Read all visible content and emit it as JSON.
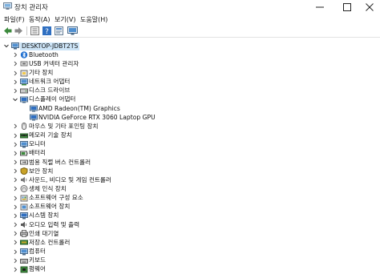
{
  "window": {
    "title": "장치 관리자"
  },
  "menu": [
    "파일(F)",
    "동작(A)",
    "보기(V)",
    "도움말(H)"
  ],
  "tree": {
    "root": "DESKTOP-JDBT2TS",
    "items": [
      {
        "label": "Bluetooth",
        "icon": "bluetooth-icon",
        "expanded": false,
        "level": 1
      },
      {
        "label": "USB 커넥터 관리자",
        "icon": "usb-connector-icon",
        "expanded": false,
        "level": 1
      },
      {
        "label": "기타 장치",
        "icon": "other-device-icon",
        "expanded": false,
        "level": 1
      },
      {
        "label": "네트워크 어댑터",
        "icon": "network-adapter-icon",
        "expanded": false,
        "level": 1
      },
      {
        "label": "디스크 드라이브",
        "icon": "disk-drive-icon",
        "expanded": false,
        "level": 1
      },
      {
        "label": "디스플레이 어댑터",
        "icon": "display-adapter-icon",
        "expanded": true,
        "level": 1
      },
      {
        "label": "AMD Radeon(TM) Graphics",
        "icon": "gpu-icon",
        "level": 2
      },
      {
        "label": "NVIDIA GeForce RTX 3060 Laptop GPU",
        "icon": "gpu-icon",
        "level": 2
      },
      {
        "label": "마우스 및 기타 포인팅 장치",
        "icon": "mouse-icon",
        "expanded": false,
        "level": 1
      },
      {
        "label": "메모리 기술 장치",
        "icon": "memory-device-icon",
        "expanded": false,
        "level": 1
      },
      {
        "label": "모니터",
        "icon": "monitor-icon",
        "expanded": false,
        "level": 1
      },
      {
        "label": "배터리",
        "icon": "battery-icon",
        "expanded": false,
        "level": 1
      },
      {
        "label": "범용 직렬 버스 컨트롤러",
        "icon": "usb-controller-icon",
        "expanded": false,
        "level": 1
      },
      {
        "label": "보안 장치",
        "icon": "security-device-icon",
        "expanded": false,
        "level": 1
      },
      {
        "label": "사운드, 비디오 및 게임 컨트롤러",
        "icon": "sound-icon",
        "expanded": false,
        "level": 1
      },
      {
        "label": "생체 인식 장치",
        "icon": "biometric-icon",
        "expanded": false,
        "level": 1
      },
      {
        "label": "소프트웨어 구성 요소",
        "icon": "software-component-icon",
        "expanded": false,
        "level": 1
      },
      {
        "label": "소프트웨어 장치",
        "icon": "software-device-icon",
        "expanded": false,
        "level": 1
      },
      {
        "label": "시스템 장치",
        "icon": "system-device-icon",
        "expanded": false,
        "level": 1
      },
      {
        "label": "오디오 입력 및 출력",
        "icon": "audio-io-icon",
        "expanded": false,
        "level": 1
      },
      {
        "label": "인쇄 대기열",
        "icon": "print-queue-icon",
        "expanded": false,
        "level": 1
      },
      {
        "label": "저장소 컨트롤러",
        "icon": "storage-controller-icon",
        "expanded": false,
        "level": 1
      },
      {
        "label": "컴퓨터",
        "icon": "computer-icon",
        "expanded": false,
        "level": 1
      },
      {
        "label": "키보드",
        "icon": "keyboard-icon",
        "expanded": false,
        "level": 1
      },
      {
        "label": "펌웨어",
        "icon": "firmware-icon",
        "expanded": false,
        "level": 1
      }
    ]
  },
  "colors": {
    "selection": "#cce4f7",
    "accent": "#0b6fc6"
  }
}
